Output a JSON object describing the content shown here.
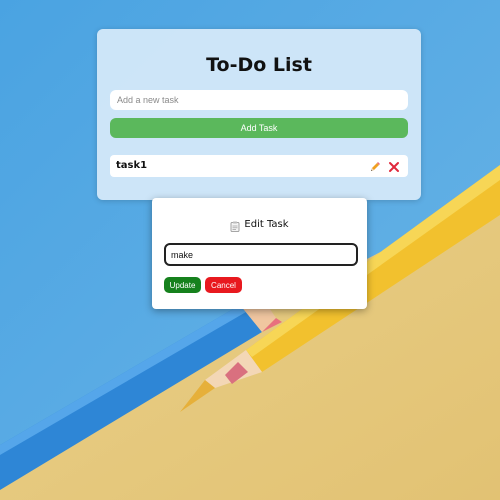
{
  "app": {
    "title": "To-Do List",
    "new_task_placeholder": "Add a new task",
    "new_task_value": "",
    "add_button_label": "Add Task",
    "tasks": [
      {
        "text": "task1",
        "edit_icon": "pencil-icon",
        "delete_icon": "close-icon"
      }
    ]
  },
  "edit_modal": {
    "title": "Edit Task",
    "title_icon": "clipboard-icon",
    "input_value": "make",
    "update_label": "Update",
    "cancel_label": "Cancel"
  },
  "colors": {
    "add_button": "#5bb85c",
    "update_button": "#16811d",
    "cancel_button": "#e8191f",
    "edit_icon": "#f0a020",
    "delete_icon": "#e0283c",
    "card_background": "#d6e9fa"
  }
}
